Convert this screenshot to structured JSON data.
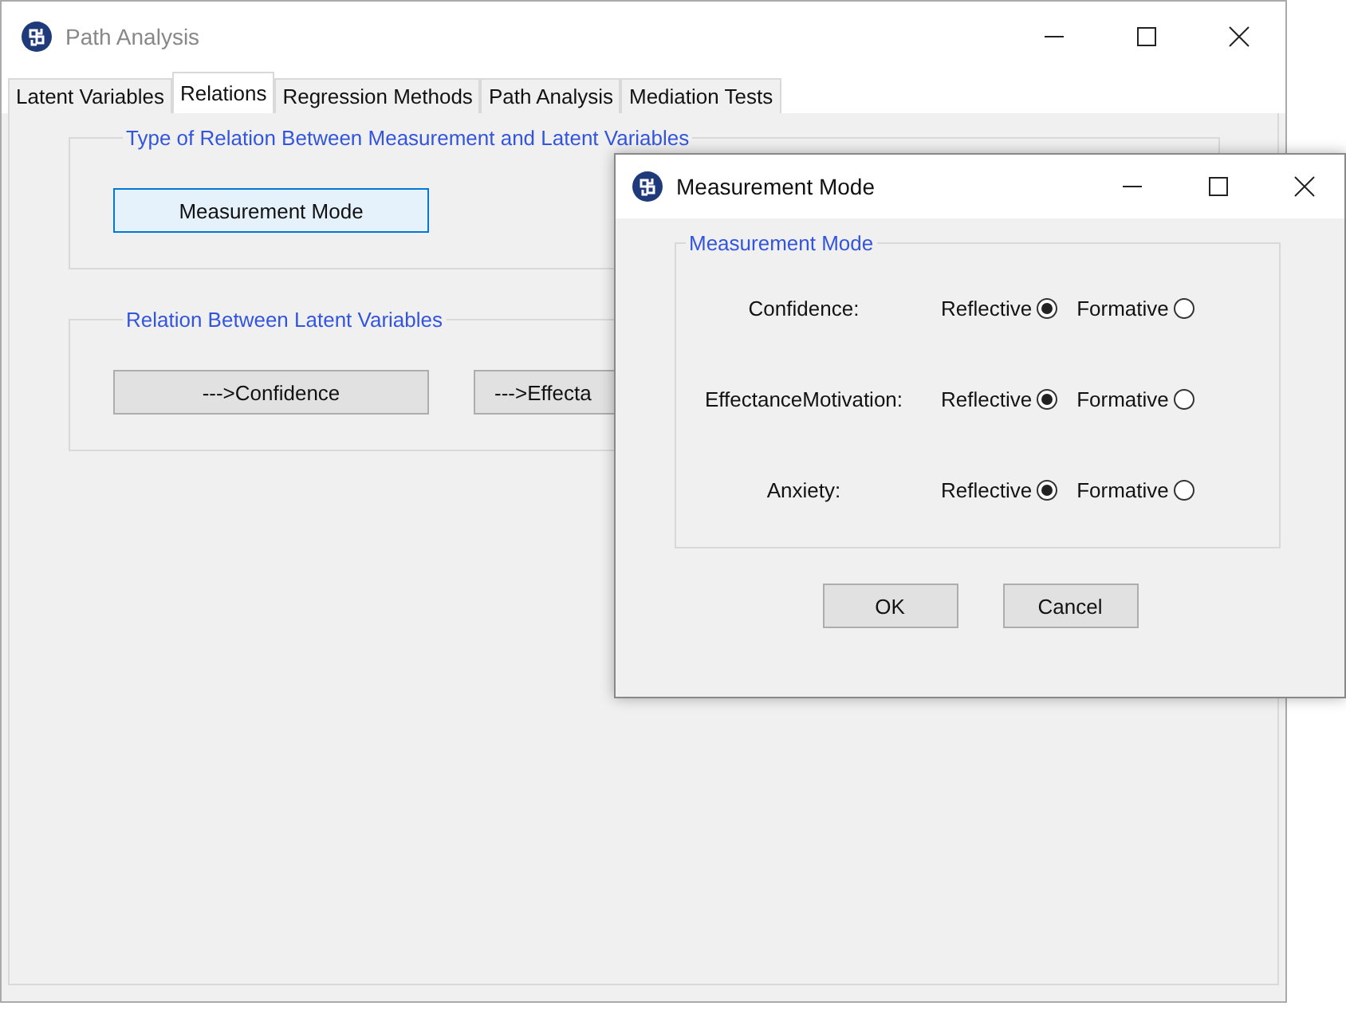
{
  "window": {
    "title": "Path Analysis"
  },
  "tabs": [
    {
      "label": "Latent Variables",
      "selected": false
    },
    {
      "label": "Relations",
      "selected": true
    },
    {
      "label": "Regression Methods",
      "selected": false
    },
    {
      "label": "Path Analysis",
      "selected": false
    },
    {
      "label": "Mediation Tests",
      "selected": false
    }
  ],
  "groups": [
    {
      "title": "Type of Relation Between Measurement and Latent Variables",
      "buttons": [
        {
          "label": "Measurement Mode",
          "focused": true
        }
      ]
    },
    {
      "title": "Relation Between Latent Variables",
      "buttons": [
        {
          "label": "--->Confidence",
          "focused": false
        },
        {
          "label": "--->Effecta",
          "focused": false
        }
      ]
    }
  ],
  "dialog": {
    "title": "Measurement Mode",
    "group_title": "Measurement Mode",
    "rows": [
      {
        "label": "Confidence:",
        "options": [
          {
            "label": "Reflective",
            "selected": true
          },
          {
            "label": "Formative",
            "selected": false
          }
        ]
      },
      {
        "label": "EffectanceMotivation:",
        "options": [
          {
            "label": "Reflective",
            "selected": true
          },
          {
            "label": "Formative",
            "selected": false
          }
        ]
      },
      {
        "label": "Anxiety:",
        "options": [
          {
            "label": "Reflective",
            "selected": true
          },
          {
            "label": "Formative",
            "selected": false
          }
        ]
      }
    ],
    "buttons": [
      "OK",
      "Cancel"
    ]
  }
}
